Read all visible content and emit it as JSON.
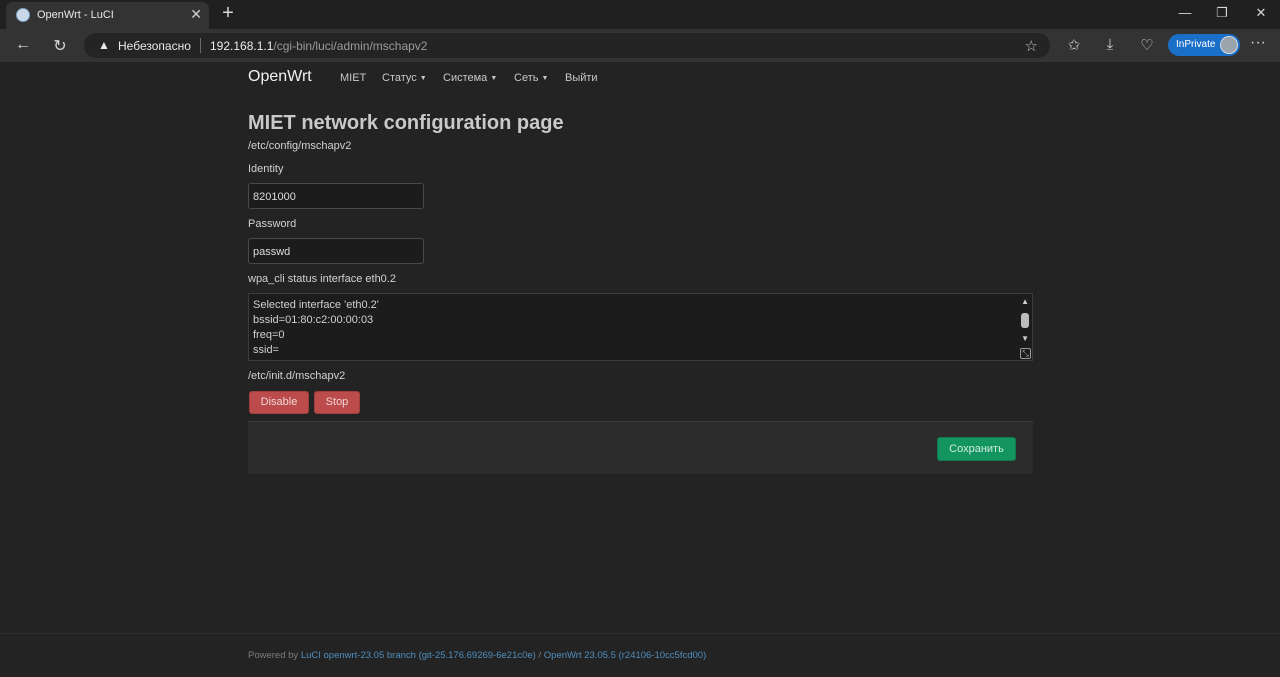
{
  "browser": {
    "tab_title": "OpenWrt - LuCI",
    "insecure_label": "Небезопасно",
    "url_host": "192.168.1.1",
    "url_path": "/cgi-bin/luci/admin/mschapv2",
    "inprivate_label": "InPrivate"
  },
  "navbar": {
    "brand": "OpenWrt",
    "items": [
      "MIET",
      "Статус",
      "Система",
      "Сеть",
      "Выйти"
    ]
  },
  "main": {
    "title": "MIET network configuration page",
    "config_path": "/etc/config/mschapv2",
    "identity_label": "Identity",
    "identity_value": "8201000",
    "password_label": "Password",
    "password_value": "passwd",
    "status_label": "wpa_cli status interface eth0.2",
    "status_lines": [
      "Selected interface 'eth0.2'",
      "bssid=01:80:c2:00:00:03",
      "freq=0",
      "ssid="
    ],
    "init_path": "/etc/init.d/mschapv2",
    "disable_label": "Disable",
    "stop_label": "Stop",
    "save_label": "Сохранить"
  },
  "footer": {
    "prefix": "Powered by ",
    "luci_link": "LuCI openwrt-23.05 branch (git-25.176.69269-6e21c0e)",
    "separator": " / ",
    "openwrt_link": "OpenWrt 23.05.5 (r24106-10cc5fcd00)"
  },
  "colors": {
    "accent_button": "#14945f",
    "negative_button": "#bc4b4b",
    "link": "#4f8fbf"
  }
}
